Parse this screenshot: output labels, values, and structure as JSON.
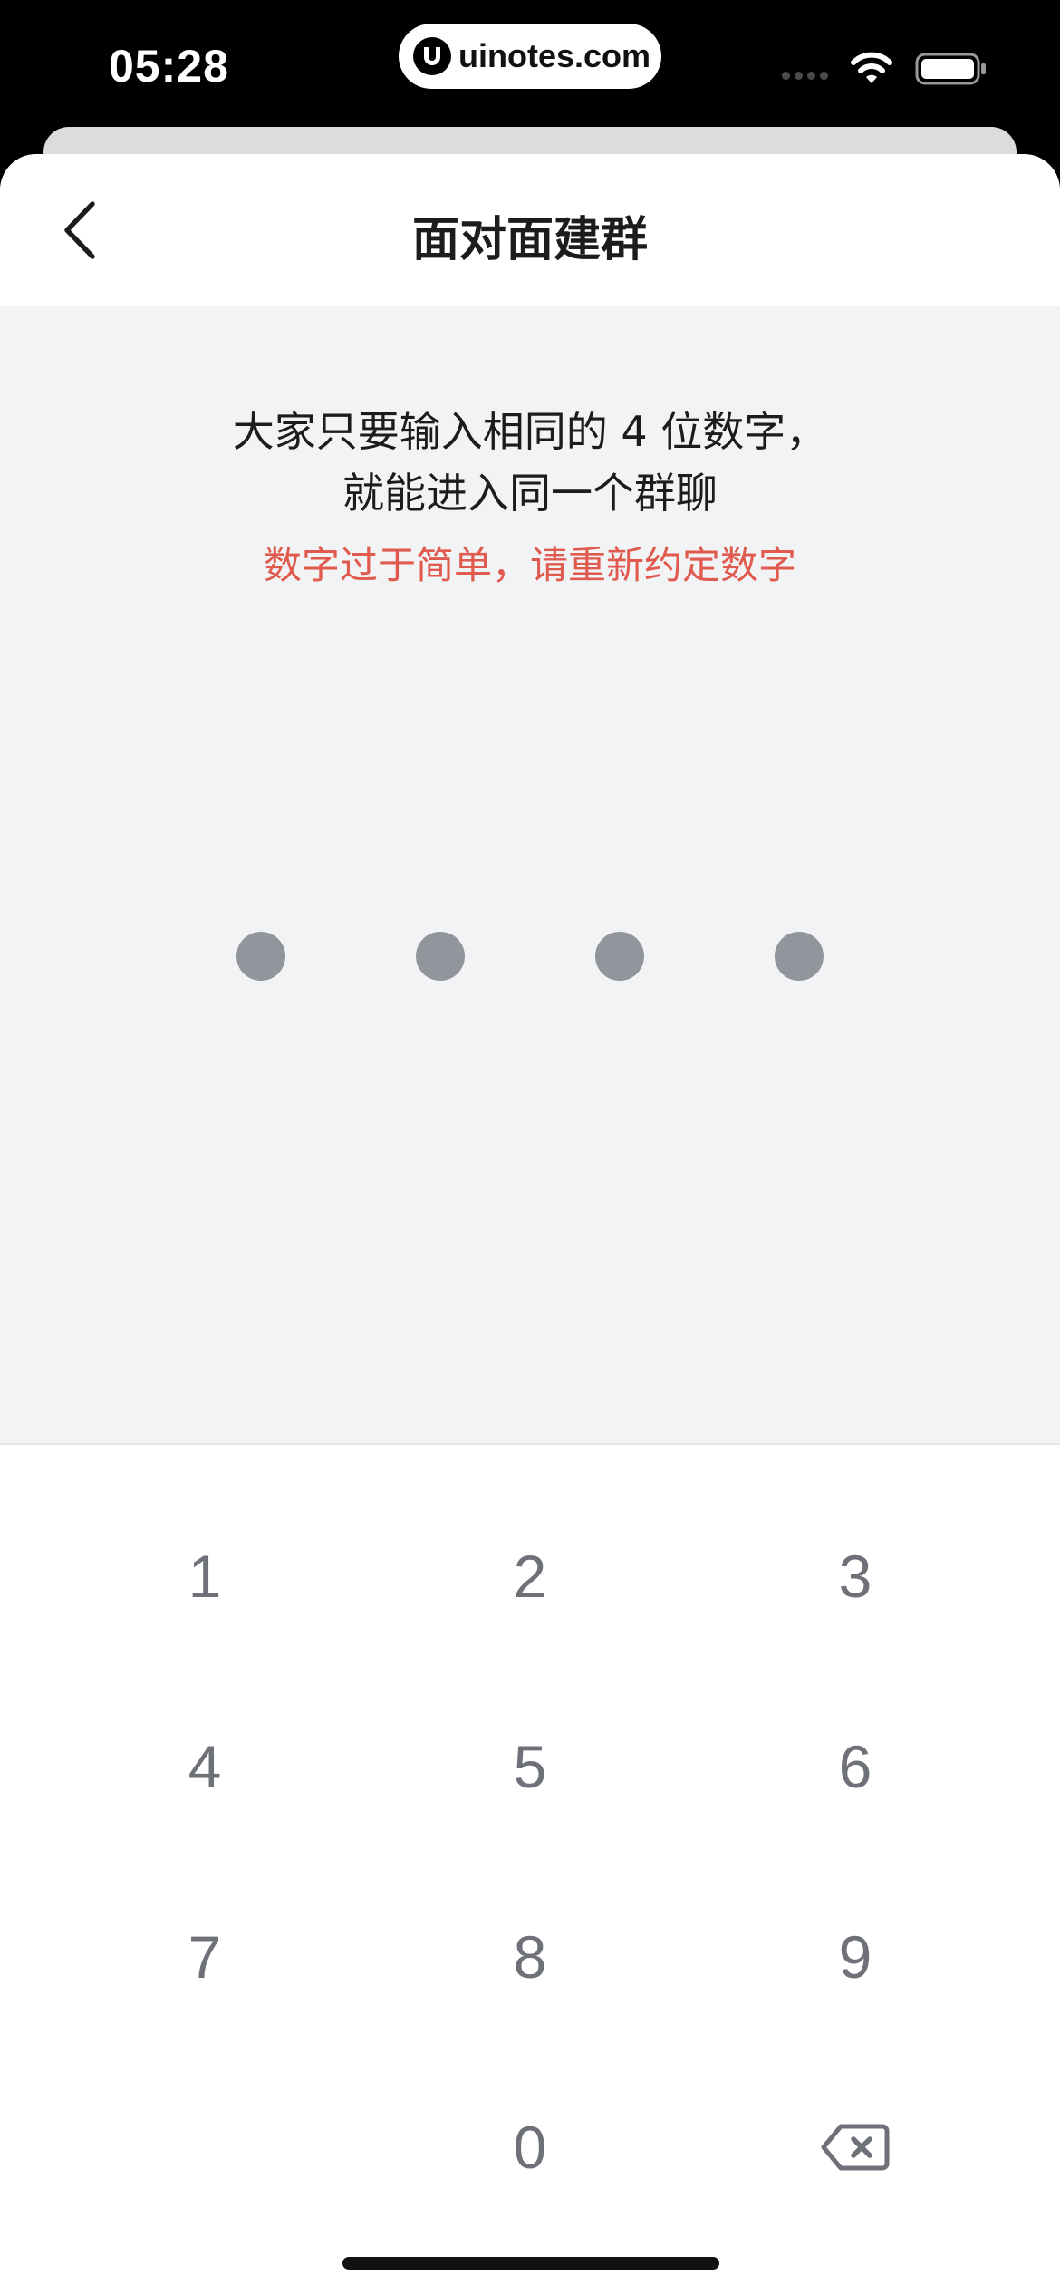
{
  "status_bar": {
    "time": "05:28",
    "url": "uinotes.com",
    "icons": [
      "signal-dots-icon",
      "wifi-icon",
      "battery-icon"
    ]
  },
  "nav": {
    "back_icon": "chevron-left-icon",
    "title": "面对面建群"
  },
  "instruction": {
    "line1": "大家只要输入相同的 4 位数字，",
    "line2": "就能进入同一个群聊",
    "error": "数字过于简单，请重新约定数字"
  },
  "pin": {
    "length": 4,
    "entered": 4
  },
  "keypad": {
    "keys": [
      "1",
      "2",
      "3",
      "4",
      "5",
      "6",
      "7",
      "8",
      "9",
      "0"
    ],
    "delete_icon": "backspace-icon"
  },
  "colors": {
    "background": "#f2f3f5",
    "error": "#e05a4e",
    "pin_dot": "#93959c",
    "key_text": "#6e7178",
    "title": "#1c1c1e"
  }
}
